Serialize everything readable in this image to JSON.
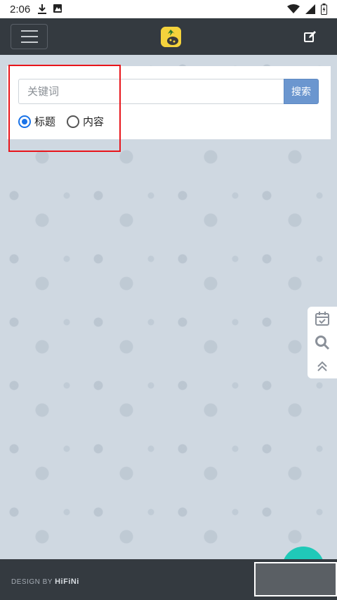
{
  "status_bar": {
    "time": "2:06",
    "left_icons": [
      "download-icon",
      "notification-icon"
    ],
    "right_icons": [
      "wifi-icon",
      "signal-icon",
      "battery-icon"
    ]
  },
  "navbar": {
    "menu_icon": "hamburger-icon",
    "logo_icon": "pineapple-logo-icon",
    "edit_icon": "edit-icon"
  },
  "search": {
    "placeholder": "关键词",
    "button_label": "搜索",
    "options": [
      {
        "label": "标题",
        "checked": true
      },
      {
        "label": "内容",
        "checked": false
      }
    ]
  },
  "float_toolbar": {
    "items": [
      "calendar-check-icon",
      "search-icon",
      "scroll-top-icon"
    ]
  },
  "footer": {
    "design_by": "DESIGN BY",
    "brand": "HiFiNi"
  },
  "colors": {
    "navbar": "#343a40",
    "search_button": "#6b96cf",
    "highlight": "#e8151b",
    "radio_checked": "#1a73e8",
    "background": "#cfd8e1",
    "fab": "#20c9b8"
  }
}
